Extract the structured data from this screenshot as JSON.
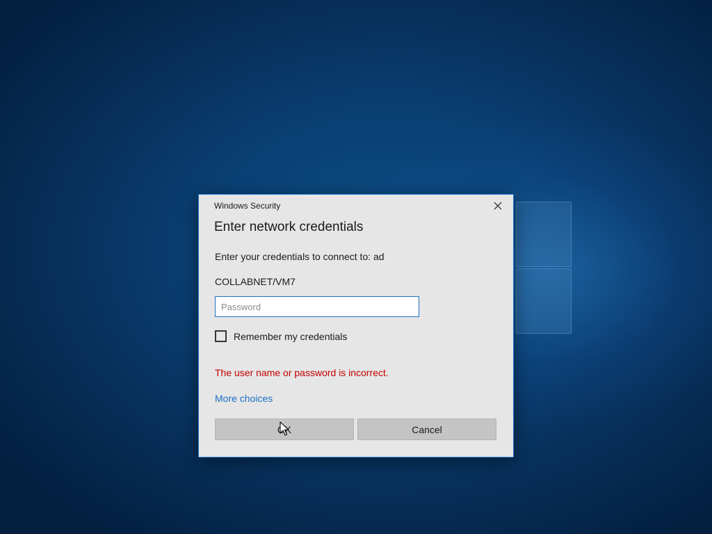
{
  "dialog": {
    "caption": "Windows Security",
    "title": "Enter network credentials",
    "prompt": "Enter your credentials to connect to: ad",
    "username": "COLLABNET/VM7",
    "password": {
      "value": "",
      "placeholder": "Password"
    },
    "remember_label": "Remember my credentials",
    "remember_checked": false,
    "error_message": "The user name or password is incorrect.",
    "more_choices_label": "More choices",
    "ok_label": "OK",
    "cancel_label": "Cancel"
  },
  "icons": {
    "close": "close-icon",
    "cursor": "mouse-pointer-icon",
    "logo": "windows-logo-icon"
  },
  "colors": {
    "accent": "#1f7ad1",
    "error": "#c40000",
    "link": "#1a6fc4",
    "dialog_bg": "#e6e6e6",
    "button_bg": "#c4c4c4"
  }
}
